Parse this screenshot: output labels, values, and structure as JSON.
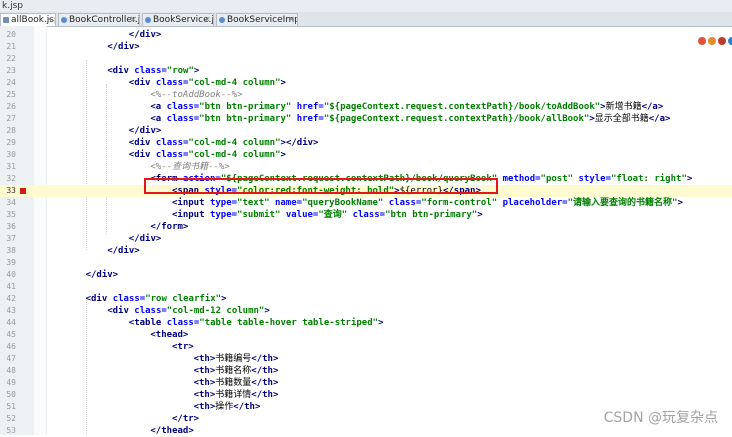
{
  "window": {
    "title": "k.jsp"
  },
  "tabs": [
    {
      "label": "allBook.jsp",
      "active": true,
      "type": "jsp"
    },
    {
      "label": "BookController.java",
      "active": false,
      "type": "java"
    },
    {
      "label": "BookService.java",
      "active": false,
      "type": "java"
    },
    {
      "label": "BookServiceImpl.java",
      "active": false,
      "type": "java"
    }
  ],
  "editor": {
    "current_line": 33,
    "breakpoint_line": 33,
    "lines": [
      {
        "n": "20",
        "indent": 12,
        "parts": [
          [
            "tg",
            "</div>"
          ]
        ]
      },
      {
        "n": "21",
        "indent": 8,
        "parts": [
          [
            "tg",
            "</div>"
          ]
        ]
      },
      {
        "n": "22",
        "indent": 0,
        "parts": []
      },
      {
        "n": "23",
        "indent": 8,
        "parts": [
          [
            "tg",
            "<div "
          ],
          [
            "at",
            "class="
          ],
          [
            "vl",
            "\"row\""
          ],
          [
            "tg",
            ">"
          ]
        ]
      },
      {
        "n": "24",
        "indent": 12,
        "parts": [
          [
            "tg",
            "<div "
          ],
          [
            "at",
            "class="
          ],
          [
            "vl",
            "\"col-md-4 column\""
          ],
          [
            "tg",
            ">"
          ]
        ]
      },
      {
        "n": "25",
        "indent": 16,
        "parts": [
          [
            "cm",
            "<%--toAddBook--%>"
          ]
        ]
      },
      {
        "n": "26",
        "indent": 16,
        "parts": [
          [
            "tg",
            "<a "
          ],
          [
            "at",
            "class="
          ],
          [
            "vl",
            "\"btn btn-primary\""
          ],
          [
            "tg",
            " "
          ],
          [
            "at",
            "href="
          ],
          [
            "vl",
            "\"${pageContext.request.contextPath}/book/toAddBook\""
          ],
          [
            "tg",
            ">"
          ],
          [
            "tx",
            "新增书籍"
          ],
          [
            "tg",
            "</a>"
          ]
        ]
      },
      {
        "n": "27",
        "indent": 16,
        "parts": [
          [
            "tg",
            "<a "
          ],
          [
            "at",
            "class="
          ],
          [
            "vl",
            "\"btn btn-primary\""
          ],
          [
            "tg",
            " "
          ],
          [
            "at",
            "href="
          ],
          [
            "vl",
            "\"${pageContext.request.contextPath}/book/allBook\""
          ],
          [
            "tg",
            ">"
          ],
          [
            "tx",
            "显示全部书籍"
          ],
          [
            "tg",
            "</a>"
          ]
        ]
      },
      {
        "n": "28",
        "indent": 12,
        "parts": [
          [
            "tg",
            "</div>"
          ]
        ]
      },
      {
        "n": "29",
        "indent": 12,
        "parts": [
          [
            "tg",
            "<div "
          ],
          [
            "at",
            "class="
          ],
          [
            "vl",
            "\"col-md-4 column\""
          ],
          [
            "tg",
            "></div>"
          ]
        ]
      },
      {
        "n": "30",
        "indent": 12,
        "parts": [
          [
            "tg",
            "<div "
          ],
          [
            "at",
            "class="
          ],
          [
            "vl",
            "\"col-md-4 column\""
          ],
          [
            "tg",
            ">"
          ]
        ]
      },
      {
        "n": "31",
        "indent": 16,
        "parts": [
          [
            "cm",
            "<%--查询书籍--%>"
          ]
        ]
      },
      {
        "n": "32",
        "indent": 16,
        "parts": [
          [
            "tg",
            "<form "
          ],
          [
            "at",
            "action="
          ],
          [
            "vl",
            "\"${pageContext.request.contextPath}/book/queryBook\""
          ],
          [
            "tg",
            " "
          ],
          [
            "at",
            "method="
          ],
          [
            "vl",
            "\"post\""
          ],
          [
            "tg",
            " "
          ],
          [
            "at",
            "style="
          ],
          [
            "vl",
            "\"float: right\""
          ],
          [
            "tg",
            ">"
          ]
        ]
      },
      {
        "n": "33",
        "indent": 20,
        "parts": [
          [
            "tg",
            "<span "
          ],
          [
            "at",
            "style="
          ],
          [
            "vl",
            "\"color:red;font-weight: bold\""
          ],
          [
            "tg",
            ">"
          ],
          [
            "tx",
            "${error}"
          ],
          [
            "tg",
            "</span>"
          ]
        ]
      },
      {
        "n": "34",
        "indent": 20,
        "parts": [
          [
            "tg",
            "<input "
          ],
          [
            "at",
            "type="
          ],
          [
            "vl",
            "\"text\""
          ],
          [
            "tg",
            " "
          ],
          [
            "at",
            "name="
          ],
          [
            "vl",
            "\"queryBookName\""
          ],
          [
            "tg",
            " "
          ],
          [
            "at",
            "class="
          ],
          [
            "vl",
            "\"form-control\""
          ],
          [
            "tg",
            " "
          ],
          [
            "at",
            "placeholder="
          ],
          [
            "vl",
            "\"请输入要查询的书籍名称\""
          ],
          [
            "tg",
            ">"
          ]
        ]
      },
      {
        "n": "35",
        "indent": 20,
        "parts": [
          [
            "tg",
            "<input "
          ],
          [
            "at",
            "type="
          ],
          [
            "vl",
            "\"submit\""
          ],
          [
            "tg",
            " "
          ],
          [
            "at",
            "value="
          ],
          [
            "vl",
            "\"查询\""
          ],
          [
            "tg",
            " "
          ],
          [
            "at",
            "class="
          ],
          [
            "vl",
            "\"btn btn-primary\""
          ],
          [
            "tg",
            ">"
          ]
        ]
      },
      {
        "n": "36",
        "indent": 16,
        "parts": [
          [
            "tg",
            "</form>"
          ]
        ]
      },
      {
        "n": "37",
        "indent": 12,
        "parts": [
          [
            "tg",
            "</div>"
          ]
        ]
      },
      {
        "n": "38",
        "indent": 8,
        "parts": [
          [
            "tg",
            "</div>"
          ]
        ]
      },
      {
        "n": "39",
        "indent": 0,
        "parts": []
      },
      {
        "n": "40",
        "indent": 4,
        "parts": [
          [
            "tg",
            "</div>"
          ]
        ]
      },
      {
        "n": "41",
        "indent": 0,
        "parts": []
      },
      {
        "n": "42",
        "indent": 4,
        "parts": [
          [
            "tg",
            "<div "
          ],
          [
            "at",
            "class="
          ],
          [
            "vl",
            "\"row clearfix\""
          ],
          [
            "tg",
            ">"
          ]
        ]
      },
      {
        "n": "43",
        "indent": 8,
        "parts": [
          [
            "tg",
            "<div "
          ],
          [
            "at",
            "class="
          ],
          [
            "vl",
            "\"col-md-12 column\""
          ],
          [
            "tg",
            ">"
          ]
        ]
      },
      {
        "n": "44",
        "indent": 12,
        "parts": [
          [
            "tg",
            "<table "
          ],
          [
            "at",
            "class="
          ],
          [
            "vl",
            "\"table table-hover table-striped\""
          ],
          [
            "tg",
            ">"
          ]
        ]
      },
      {
        "n": "45",
        "indent": 16,
        "parts": [
          [
            "tg",
            "<thead>"
          ]
        ]
      },
      {
        "n": "46",
        "indent": 20,
        "parts": [
          [
            "tg",
            "<tr>"
          ]
        ]
      },
      {
        "n": "47",
        "indent": 24,
        "parts": [
          [
            "tg",
            "<th>"
          ],
          [
            "tx",
            "书籍编号"
          ],
          [
            "tg",
            "</th>"
          ]
        ]
      },
      {
        "n": "48",
        "indent": 24,
        "parts": [
          [
            "tg",
            "<th>"
          ],
          [
            "tx",
            "书籍名称"
          ],
          [
            "tg",
            "</th>"
          ]
        ]
      },
      {
        "n": "49",
        "indent": 24,
        "parts": [
          [
            "tg",
            "<th>"
          ],
          [
            "tx",
            "书籍数量"
          ],
          [
            "tg",
            "</th>"
          ]
        ]
      },
      {
        "n": "50",
        "indent": 24,
        "parts": [
          [
            "tg",
            "<th>"
          ],
          [
            "tx",
            "书籍详情"
          ],
          [
            "tg",
            "</th>"
          ]
        ]
      },
      {
        "n": "51",
        "indent": 24,
        "parts": [
          [
            "tg",
            "<th>"
          ],
          [
            "tx",
            "操作"
          ],
          [
            "tg",
            "</th>"
          ]
        ]
      },
      {
        "n": "52",
        "indent": 20,
        "parts": [
          [
            "tg",
            "</tr>"
          ]
        ]
      },
      {
        "n": "53",
        "indent": 16,
        "parts": [
          [
            "tg",
            "</thead>"
          ]
        ]
      }
    ]
  },
  "watermark": "CSDN @玩复杂点",
  "colors": {
    "tag": "#00007f",
    "attr": "#0000ff",
    "value": "#007f00",
    "comment": "#808080",
    "highlight_box": "#e21818"
  }
}
